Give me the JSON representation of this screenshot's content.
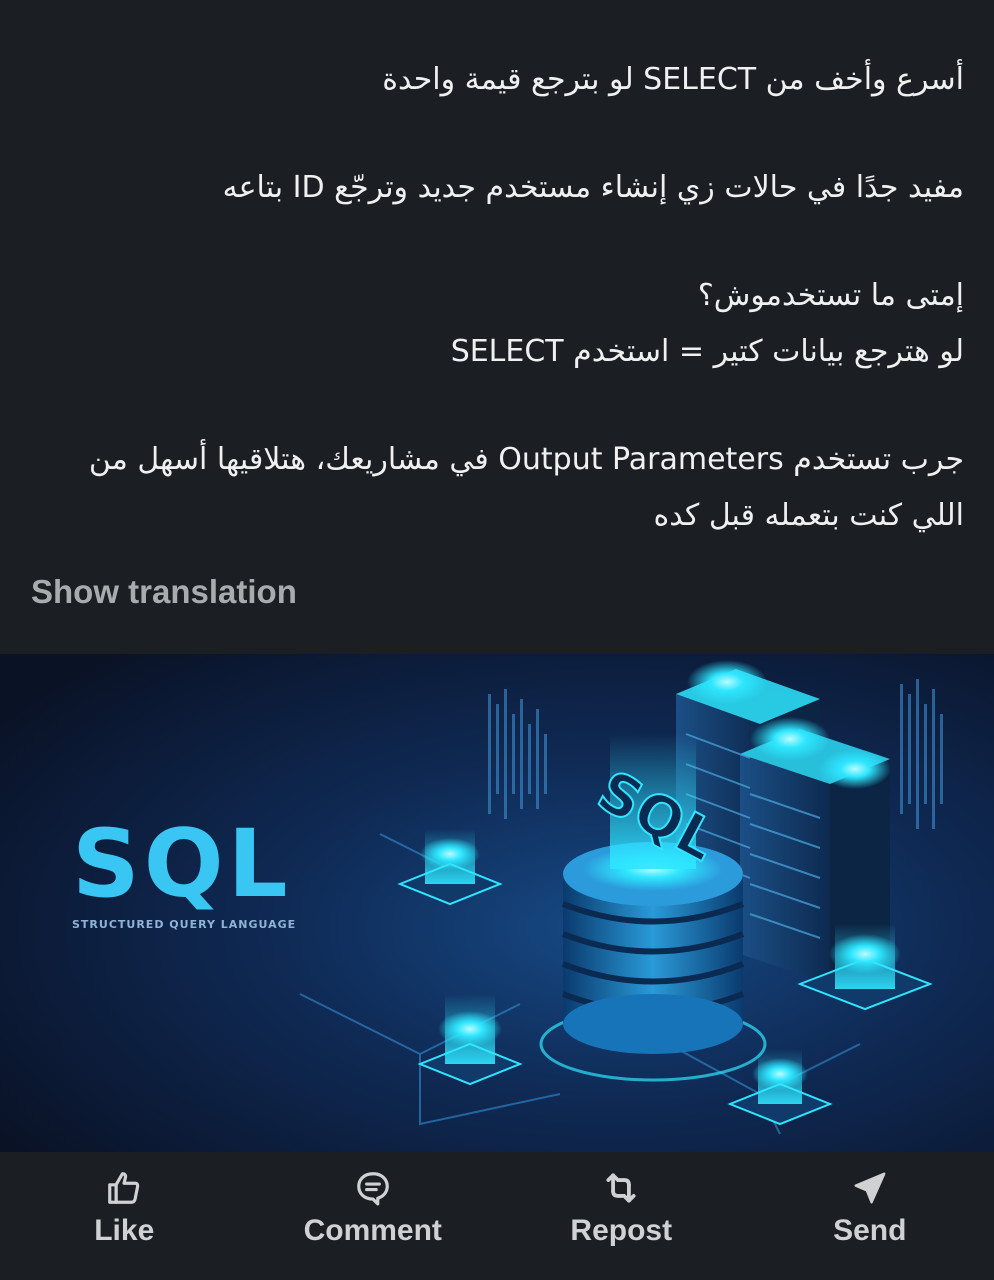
{
  "post": {
    "paragraphs": [
      [
        "أسرع وأخف من SELECT لو بترجع قيمة واحدة"
      ],
      [
        "مفيد جدًا في حالات زي إنشاء مستخدم جديد وترجّع ID بتاعه"
      ],
      [
        "إمتى ما تستخدموش؟",
        "لو هترجع بيانات كتير = استخدم SELECT"
      ],
      [
        "جرب تستخدم Output Parameters في مشاريعك، هتلاقيها أسهل من",
        "اللي كنت بتعمله قبل كده"
      ]
    ],
    "show_translation": "Show translation"
  },
  "image": {
    "logo_text": "SQL",
    "logo_subtitle": "STRUCTURED QUERY LANGUAGE",
    "cylinder_text": "SQL",
    "colors": {
      "background_dark": "#0a1226",
      "background_mid": "#0f2a55",
      "glow": "#2ee6ff",
      "accent": "#39c6f2"
    }
  },
  "actions": [
    {
      "label": "Like",
      "icon": "thumbs-up-icon"
    },
    {
      "label": "Comment",
      "icon": "comment-icon"
    },
    {
      "label": "Repost",
      "icon": "repost-icon"
    },
    {
      "label": "Send",
      "icon": "send-icon"
    }
  ]
}
